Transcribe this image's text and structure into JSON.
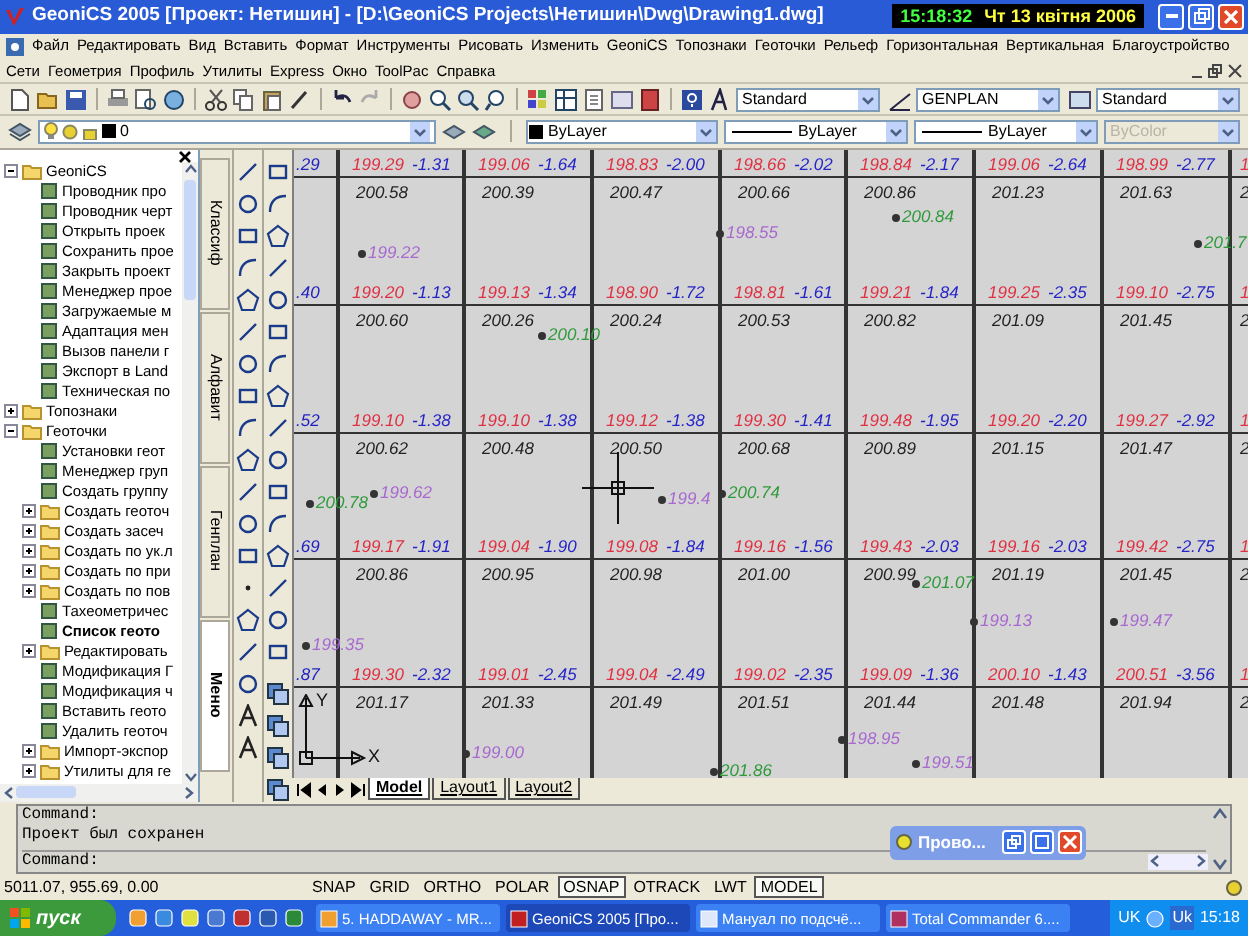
{
  "window": {
    "title": "GeoniCS 2005 [Проект: Нетишин] - [D:\\GeoniCS Projects\\Нетишин\\Dwg\\Drawing1.dwg]",
    "clock_time": "15:18:32",
    "clock_date": "Чт 13 квітня 2006"
  },
  "menu_rows": [
    [
      "Файл",
      "Редактировать",
      "Вид",
      "Вставить",
      "Формат",
      "Инструменты",
      "Рисовать",
      "Изменить",
      "GeoniCS",
      "Топознаки",
      "Геоточки",
      "Рельеф",
      "Горизонтальная",
      "Вертикальная",
      "Благоустройство"
    ],
    [
      "Сети",
      "Геометрия",
      "Профиль",
      "Утилиты",
      "Express",
      "Окно",
      "ToolPac",
      "Справка"
    ]
  ],
  "styles": {
    "text_style": "Standard",
    "dim_style": "GENPLAN",
    "table_style": "Standard"
  },
  "properties": {
    "layer": "0",
    "object_color": "ByLayer",
    "linetype": "ByLayer",
    "lineweight": "ByLayer",
    "plot_style": {
      "value": "ByColor",
      "disabled": true
    }
  },
  "tree": [
    {
      "label": "GeoniCS",
      "kind": "folder",
      "expanded": true,
      "children": [
        {
          "label": "Проводник про",
          "kind": "item"
        },
        {
          "label": "Проводник черт",
          "kind": "item"
        },
        {
          "label": "Открыть проек",
          "kind": "item"
        },
        {
          "label": "Сохранить прое",
          "kind": "item"
        },
        {
          "label": "Закрыть проект",
          "kind": "item"
        },
        {
          "label": "Менеджер прое",
          "kind": "item"
        },
        {
          "label": "Загружаемые м",
          "kind": "item"
        },
        {
          "label": "Адаптация мен",
          "kind": "item"
        },
        {
          "label": "Вызов панели г",
          "kind": "item"
        },
        {
          "label": "Экспорт в Land",
          "kind": "item"
        },
        {
          "label": "Техническая по",
          "kind": "item"
        }
      ]
    },
    {
      "label": "Топознаки",
      "kind": "folder",
      "expanded": false
    },
    {
      "label": "Геоточки",
      "kind": "folder",
      "expanded": true,
      "children": [
        {
          "label": "Установки геот",
          "kind": "item"
        },
        {
          "label": "Менеджер груп",
          "kind": "item"
        },
        {
          "label": "Создать группу",
          "kind": "item"
        },
        {
          "label": "Создать геоточ",
          "kind": "folder",
          "expanded": false
        },
        {
          "label": "Создать засеч",
          "kind": "folder",
          "expanded": false
        },
        {
          "label": "Создать по ук.л",
          "kind": "folder",
          "expanded": false
        },
        {
          "label": "Создать по при",
          "kind": "folder",
          "expanded": false
        },
        {
          "label": "Создать по пов",
          "kind": "folder",
          "expanded": false
        },
        {
          "label": "Тахеометричес",
          "kind": "item"
        },
        {
          "label": "Список геото",
          "kind": "item",
          "bold": true
        },
        {
          "label": "Редактировать",
          "kind": "folder",
          "expanded": false
        },
        {
          "label": "Модификация Г",
          "kind": "item"
        },
        {
          "label": "Модификация ч",
          "kind": "item"
        },
        {
          "label": "Вставить геото",
          "kind": "item"
        },
        {
          "label": "Удалить геоточ",
          "kind": "item"
        },
        {
          "label": "Импорт-экспор",
          "kind": "folder",
          "expanded": false
        },
        {
          "label": "Утилиты для ге",
          "kind": "folder",
          "expanded": false
        }
      ]
    }
  ],
  "side_tabs": [
    {
      "label": "Классиф",
      "selected": false
    },
    {
      "label": "Алфавит",
      "selected": false
    },
    {
      "label": "Генплан",
      "selected": false
    },
    {
      "label": "Меню",
      "selected": true
    }
  ],
  "grid_rows": [
    {
      "edge_label": ".29",
      "edge_right_label": "1",
      "edge_right_value": "2",
      "cells": [
        [
          "199.29",
          "-1.31",
          "200.58"
        ],
        [
          "199.06",
          "-1.64",
          "200.39"
        ],
        [
          "198.83",
          "-2.00",
          "200.47"
        ],
        [
          "198.66",
          "-2.02",
          "200.66"
        ],
        [
          "198.84",
          "-2.17",
          "200.86"
        ],
        [
          "199.06",
          "-2.64",
          "201.23"
        ],
        [
          "198.99",
          "-2.77",
          "201.63"
        ]
      ]
    },
    {
      "edge_label": ".40",
      "edge_right_label": "1",
      "edge_right_value": "2",
      "cells": [
        [
          "199.20",
          "-1.13",
          "200.60"
        ],
        [
          "199.13",
          "-1.34",
          "200.26"
        ],
        [
          "198.90",
          "-1.72",
          "200.24"
        ],
        [
          "198.81",
          "-1.61",
          "200.53"
        ],
        [
          "199.21",
          "-1.84",
          "200.82"
        ],
        [
          "199.25",
          "-2.35",
          "201.09"
        ],
        [
          "199.10",
          "-2.75",
          "201.45"
        ]
      ]
    },
    {
      "edge_label": ".52",
      "edge_right_label": "1",
      "edge_right_value": "2",
      "cells": [
        [
          "199.10",
          "-1.38",
          "200.62"
        ],
        [
          "199.10",
          "-1.38",
          "200.48"
        ],
        [
          "199.12",
          "-1.38",
          "200.50"
        ],
        [
          "199.30",
          "-1.41",
          "200.68"
        ],
        [
          "199.48",
          "-1.95",
          "200.89"
        ],
        [
          "199.20",
          "-2.20",
          "201.15"
        ],
        [
          "199.27",
          "-2.92",
          "201.47"
        ]
      ]
    },
    {
      "edge_label": ".69",
      "edge_right_label": "1",
      "edge_right_value": "2",
      "cells": [
        [
          "199.17",
          "-1.91",
          "200.86"
        ],
        [
          "199.04",
          "-1.90",
          "200.95"
        ],
        [
          "199.08",
          "-1.84",
          "200.98"
        ],
        [
          "199.16",
          "-1.56",
          "201.00"
        ],
        [
          "199.43",
          "-2.03",
          "200.99"
        ],
        [
          "199.16",
          "-2.03",
          "201.19"
        ],
        [
          "199.42",
          "-2.75",
          "201.45"
        ]
      ]
    },
    {
      "edge_label": ".87",
      "edge_right_label": "1",
      "edge_right_value": "2",
      "cells": [
        [
          "199.30",
          "-2.32",
          "201.17"
        ],
        [
          "199.01",
          "-2.45",
          "201.33"
        ],
        [
          "199.04",
          "-2.49",
          "201.49"
        ],
        [
          "199.02",
          "-2.35",
          "201.51"
        ],
        [
          "199.09",
          "-1.36",
          "201.44"
        ],
        [
          "200.10",
          "-1.43",
          "201.48"
        ],
        [
          "200.51",
          "-3.56",
          "201.94"
        ]
      ]
    }
  ],
  "points": [
    {
      "label": "199.22",
      "color": "#a868d0"
    },
    {
      "label": "198.55",
      "color": "#a868d0"
    },
    {
      "label": "200.84",
      "color": "#2e9a3a"
    },
    {
      "label": "201.7",
      "color": "#2e9a3a"
    },
    {
      "label": "200.10",
      "color": "#2e9a3a"
    },
    {
      "label": "200.78",
      "color": "#2e9a3a"
    },
    {
      "label": "199.62",
      "color": "#a868d0"
    },
    {
      "label": "199.4",
      "color": "#a868d0"
    },
    {
      "label": "200.74",
      "color": "#2e9a3a"
    },
    {
      "label": "201.07",
      "color": "#2e9a3a"
    },
    {
      "label": "199.13",
      "color": "#a868d0"
    },
    {
      "label": "199.47",
      "color": "#a868d0"
    },
    {
      "label": "199.35",
      "color": "#a868d0"
    },
    {
      "label": "199.00",
      "color": "#a868d0"
    },
    {
      "label": "198.95",
      "color": "#a868d0"
    },
    {
      "label": "199.51",
      "color": "#a868d0"
    },
    {
      "label": "201.86",
      "color": "#2e9a3a"
    }
  ],
  "ucs": {
    "x_label": "X",
    "y_label": "Y"
  },
  "layout_tabs": [
    {
      "label": "Model",
      "selected": true
    },
    {
      "label": "Layout1",
      "selected": false
    },
    {
      "label": "Layout2",
      "selected": false
    }
  ],
  "command_lines": [
    "Command:",
    "Проект был сохранен"
  ],
  "command_prompt": "Command:",
  "floating_window": {
    "title": "Прово..."
  },
  "status_bar": {
    "coordinates": "5011.07, 955.69, 0.00",
    "toggles": [
      {
        "label": "SNAP",
        "on": false
      },
      {
        "label": "GRID",
        "on": false
      },
      {
        "label": "ORTHO",
        "on": false
      },
      {
        "label": "POLAR",
        "on": false
      },
      {
        "label": "OSNAP",
        "on": true
      },
      {
        "label": "OTRACK",
        "on": false
      },
      {
        "label": "LWT",
        "on": false
      },
      {
        "label": "MODEL",
        "on": true
      }
    ]
  },
  "taskbar": {
    "start": "пуск",
    "tasks": [
      {
        "label": "5. HADDAWAY - MR...",
        "selected": false
      },
      {
        "label": "GeoniCS 2005 [Про...",
        "selected": true
      },
      {
        "label": "Мануал по подсчё...",
        "selected": false
      },
      {
        "label": "Total Commander 6....",
        "selected": false
      }
    ],
    "language": "UK",
    "language_icon": "Uk",
    "time": "15:18"
  }
}
